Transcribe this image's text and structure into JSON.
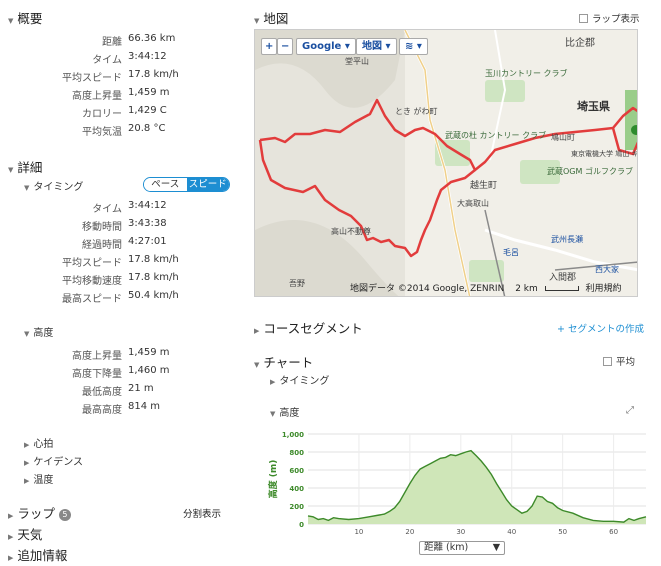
{
  "overview": {
    "title": "概要",
    "rows": [
      {
        "label": "距離",
        "value": "66.36 km"
      },
      {
        "label": "タイム",
        "value": "3:44:12"
      },
      {
        "label": "平均スピード",
        "value": "17.8 km/h"
      },
      {
        "label": "高度上昇量",
        "value": "1,459 m"
      },
      {
        "label": "カロリー",
        "value": "1,429 C"
      },
      {
        "label": "平均気温",
        "value": "20.8 °C"
      }
    ]
  },
  "details": {
    "title": "詳細",
    "timing": {
      "title": "タイミング",
      "toggle": {
        "pace": "ペース",
        "speed": "スピード",
        "active": "speed"
      },
      "rows": [
        {
          "label": "タイム",
          "value": "3:44:12"
        },
        {
          "label": "移動時間",
          "value": "3:43:38"
        },
        {
          "label": "経過時間",
          "value": "4:27:01"
        },
        {
          "label": "平均スピード",
          "value": "17.8 km/h"
        },
        {
          "label": "平均移動速度",
          "value": "17.8 km/h"
        },
        {
          "label": "最高スピード",
          "value": "50.4 km/h"
        }
      ]
    },
    "elevation": {
      "title": "高度",
      "rows": [
        {
          "label": "高度上昇量",
          "value": "1,459 m"
        },
        {
          "label": "高度下降量",
          "value": "1,460 m"
        },
        {
          "label": "最低高度",
          "value": "21 m"
        },
        {
          "label": "最高高度",
          "value": "814 m"
        }
      ]
    },
    "collapsed": [
      "心拍",
      "ケイデンス",
      "温度"
    ]
  },
  "laps": {
    "title": "ラップ",
    "count": "5",
    "split_label": "分割表示"
  },
  "weather": {
    "title": "天気"
  },
  "extra": {
    "title": "追加情報"
  },
  "map": {
    "title": "地図",
    "lap_display": "ラップ表示",
    "zoom_in": "+",
    "zoom_out": "−",
    "provider": "Google",
    "map_type": "地図",
    "footer": "地図データ ©2014 Google, ZENRIN",
    "scale": "2 km",
    "terms": "利用規約",
    "labels": [
      {
        "text": "比企郡",
        "key": "hiki"
      },
      {
        "text": "埼玉県",
        "key": "saitama"
      },
      {
        "text": "とき がわ町",
        "key": "tokigawa"
      },
      {
        "text": "武蔵の杜 カントリー クラブ",
        "key": "musashi"
      },
      {
        "text": "越生町",
        "key": "ogose"
      },
      {
        "text": "鳩山町",
        "key": "hatoyama"
      },
      {
        "text": "高山不動尊",
        "key": "takayama"
      },
      {
        "text": "大高取山",
        "key": "otakatori"
      },
      {
        "text": "毛呂",
        "key": "moro"
      },
      {
        "text": "武州長瀬",
        "key": "nagase"
      },
      {
        "text": "西大家",
        "key": "nishiooya"
      },
      {
        "text": "入間郡",
        "key": "iruma"
      },
      {
        "text": "玉川カントリー クラブ",
        "key": "tamagawa"
      },
      {
        "text": "武蔵OGM ゴルフクラブ",
        "key": "ogm"
      },
      {
        "text": "東京電機大学 鳩山 キャンパス",
        "key": "denki"
      },
      {
        "text": "吾野",
        "key": "agano"
      },
      {
        "text": "堂平山",
        "key": "dodaira"
      }
    ]
  },
  "course_segment": {
    "title": "コースセグメント",
    "create": "+ セグメントの作成"
  },
  "chart": {
    "title": "チャート",
    "average": "平均",
    "timing": "タイミング",
    "elevation_title": "高度",
    "xaxis_select": "距離 (km)"
  },
  "chart_data": {
    "type": "area",
    "title": "高度",
    "xlabel": "距離 (km)",
    "ylabel": "高度 (m)",
    "xlim": [
      0,
      66.36
    ],
    "ylim": [
      0,
      1000
    ],
    "xticks": [
      10,
      20,
      30,
      40,
      50,
      60
    ],
    "yticks": [
      0,
      200,
      400,
      600,
      800,
      1000
    ],
    "ytick_labels": [
      "0",
      "200",
      "400",
      "600",
      "800",
      "1,000"
    ],
    "grid": true,
    "color": "#3d8a2a",
    "fill": "#cfe6b8",
    "x": [
      0,
      1,
      2,
      3,
      4,
      5,
      6,
      8,
      10,
      12,
      14,
      15,
      16,
      17,
      18,
      19,
      20,
      21,
      22,
      23,
      24,
      25,
      26,
      27,
      28,
      29,
      30,
      31,
      32,
      33,
      34,
      35,
      36,
      37,
      38,
      39,
      40,
      41,
      42,
      43,
      44,
      45,
      46,
      47,
      48,
      49,
      50,
      52,
      54,
      56,
      58,
      60,
      62,
      63,
      64,
      65,
      66.36
    ],
    "y": [
      90,
      80,
      50,
      60,
      40,
      70,
      60,
      50,
      60,
      80,
      100,
      110,
      140,
      180,
      250,
      350,
      450,
      540,
      610,
      640,
      670,
      700,
      730,
      740,
      770,
      760,
      780,
      800,
      814,
      760,
      700,
      630,
      550,
      450,
      360,
      270,
      200,
      160,
      120,
      140,
      200,
      310,
      300,
      250,
      230,
      180,
      150,
      120,
      70,
      40,
      30,
      30,
      21,
      60,
      40,
      60,
      80
    ]
  }
}
